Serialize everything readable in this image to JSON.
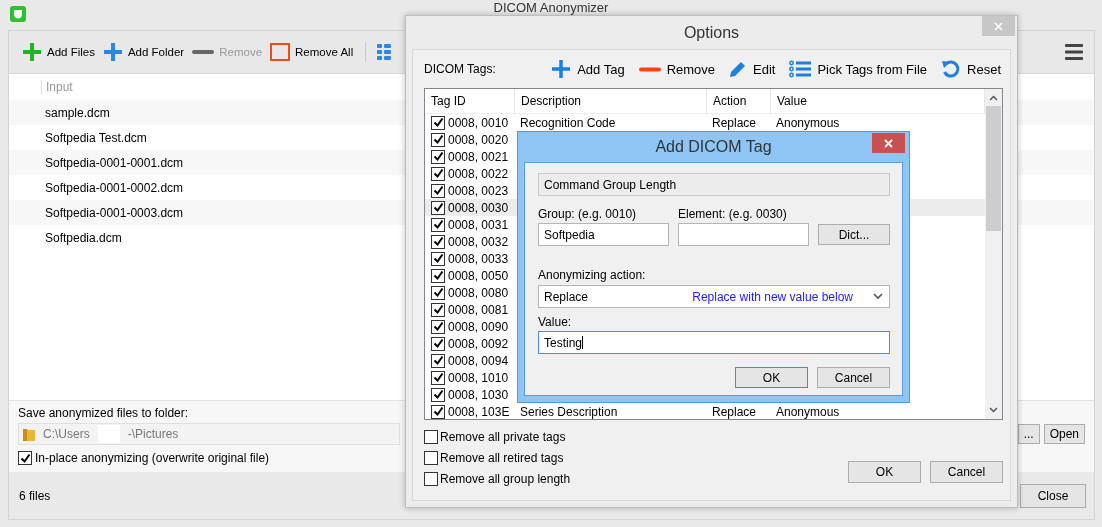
{
  "main_window": {
    "title": "DICOM Anonymizer",
    "toolbar": [
      {
        "label": "Add Files",
        "kind": "add",
        "disabled": false
      },
      {
        "label": "Add Folder",
        "kind": "folder",
        "disabled": false
      },
      {
        "label": "Remove",
        "kind": "remove",
        "disabled": true
      },
      {
        "label": "Remove All",
        "kind": "clear",
        "disabled": false
      }
    ],
    "file_list": {
      "column": "Input",
      "rows": [
        "sample.dcm",
        "Softpedia Test.dcm",
        "Softpedia-0001-0001.dcm",
        "Softpedia-0001-0002.dcm",
        "Softpedia-0001-0003.dcm",
        "Softpedia.dcm"
      ]
    },
    "output": {
      "label": "Save anonymized files to folder:",
      "path_start": "C:\\Users",
      "path_end": "-\\Pictures",
      "browse_button": "...",
      "open_button": "Open"
    },
    "in_place": {
      "label": "In-place anonymizing (overwrite original file)",
      "checked": true
    },
    "status": "6 files",
    "close_button": "Close"
  },
  "options_dialog": {
    "title": "Options",
    "tags_label": "DICOM Tags:",
    "toolbar": [
      {
        "label": "Add Tag",
        "kind": "add"
      },
      {
        "label": "Remove",
        "kind": "remove"
      },
      {
        "label": "Edit",
        "kind": "edit"
      },
      {
        "label": "Pick Tags from File",
        "kind": "list"
      },
      {
        "label": "Reset",
        "kind": "reset"
      }
    ],
    "table": {
      "columns": [
        "Tag ID",
        "Description",
        "Action",
        "Value"
      ],
      "rows": [
        {
          "id": "0008, 0010",
          "checked": true,
          "selected": false,
          "description": "Recognition Code",
          "action": "Replace",
          "value": "Anonymous"
        },
        {
          "id": "0008, 0020",
          "checked": true,
          "selected": false
        },
        {
          "id": "0008, 0021",
          "checked": true,
          "selected": false
        },
        {
          "id": "0008, 0022",
          "checked": true,
          "selected": false
        },
        {
          "id": "0008, 0023",
          "checked": true,
          "selected": false
        },
        {
          "id": "0008, 0030",
          "checked": true,
          "selected": true
        },
        {
          "id": "0008, 0031",
          "checked": true,
          "selected": false
        },
        {
          "id": "0008, 0032",
          "checked": true,
          "selected": false
        },
        {
          "id": "0008, 0033",
          "checked": true,
          "selected": false
        },
        {
          "id": "0008, 0050",
          "checked": true,
          "selected": false
        },
        {
          "id": "0008, 0080",
          "checked": true,
          "selected": false
        },
        {
          "id": "0008, 0081",
          "checked": true,
          "selected": false
        },
        {
          "id": "0008, 0090",
          "checked": true,
          "selected": false
        },
        {
          "id": "0008, 0092",
          "checked": true,
          "selected": false
        },
        {
          "id": "0008, 0094",
          "checked": true,
          "selected": false
        },
        {
          "id": "0008, 1010",
          "checked": true,
          "selected": false
        },
        {
          "id": "0008, 1030",
          "checked": true,
          "selected": false
        },
        {
          "id": "0008, 103E",
          "checked": true,
          "selected": false,
          "description": "Series Description",
          "action": "Replace",
          "value": "Anonymous"
        }
      ]
    },
    "options": [
      {
        "label": "Remove all private tags",
        "checked": false
      },
      {
        "label": "Remove all retired tags",
        "checked": false
      },
      {
        "label": "Remove all group length",
        "checked": false
      }
    ],
    "buttons": [
      "OK",
      "Cancel"
    ]
  },
  "add_tag_dialog": {
    "title": "Add DICOM Tag",
    "tag_name": "Command Group Length",
    "group": {
      "label": "Group: (e.g. 0010)",
      "value": "Softpedia"
    },
    "element": {
      "label": "Element: (e.g. 0030)"
    },
    "dict_button": "Dict...",
    "action": {
      "label": "Anonymizing action:",
      "value": "Replace",
      "hint": "Replace with new value below"
    },
    "value": {
      "label": "Value:",
      "value": "Testing"
    },
    "buttons": [
      "OK",
      "Cancel"
    ]
  }
}
